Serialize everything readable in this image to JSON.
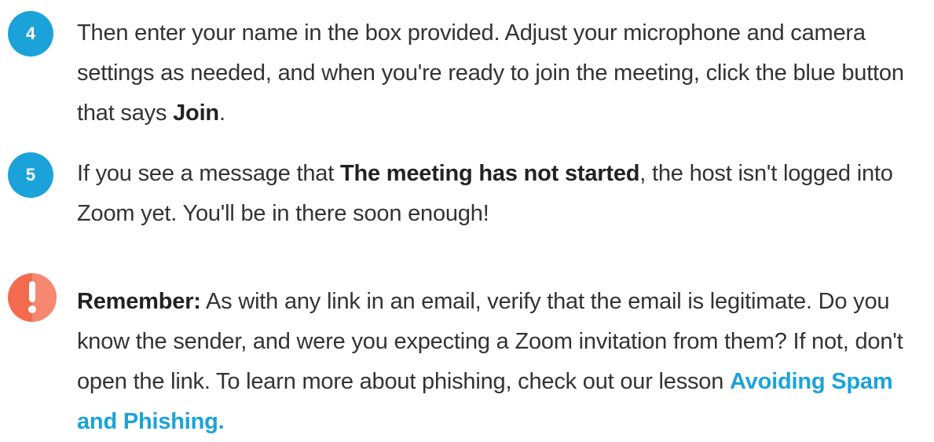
{
  "steps": [
    {
      "number": "4",
      "pre": "Then enter your name in the box provided. Adjust your microphone and camera settings as needed, and when you're ready to join the meeting, click the blue button that says ",
      "bold": "Join",
      "post": "."
    },
    {
      "number": "5",
      "pre": "If you see a message that ",
      "bold": "The meeting has not started",
      "post": ", the host isn't logged into Zoom yet. You'll be in there soon enough!"
    }
  ],
  "note": {
    "icon": "exclamation-icon",
    "label": "Remember:",
    "text": " As with any link in an email, verify that the email is legitimate. Do you know the sender, and were you expecting a Zoom invitation from them? If not, don't open the link. To learn more about phishing, check out our lesson ",
    "link_text": "Avoiding Spam and Phishing."
  },
  "colors": {
    "badge_blue": "#1ba3d9",
    "alert_orange": "#f26b4f",
    "link_blue": "#1ba3d9",
    "text": "#333333"
  }
}
